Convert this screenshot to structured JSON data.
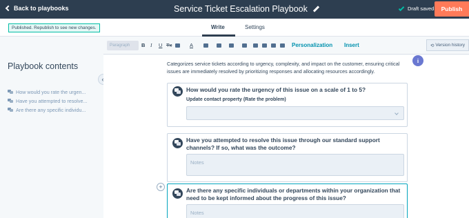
{
  "header": {
    "back_label": "Back to playbooks",
    "title": "Service Ticket Escalation Playbook",
    "save_status": "Draft saved",
    "publish_label": "Publish"
  },
  "tabs": {
    "status_message": "Published. Republish to see new changes.",
    "write_label": "Write",
    "settings_label": "Settings"
  },
  "sidebar": {
    "heading": "Playbook contents",
    "items": [
      {
        "label": "How would you rate the urgen..."
      },
      {
        "label": "Have you attempted to resolve..."
      },
      {
        "label": "Are there any specific individu..."
      }
    ]
  },
  "toolbar": {
    "paragraph_label": "Paragraph",
    "bold": "B",
    "italic": "I",
    "underline": "U",
    "strikethrough": "Tx",
    "font_color": "A",
    "personalization_label": "Personalization",
    "insert_label": "Insert",
    "version_history_label": "Version history"
  },
  "content": {
    "intro": "Categorizes service tickets according to urgency, complexity, and impact on the customer, ensuring critical issues are immediately resolved by prioritizing responses and allocating resources accordingly.",
    "questions": [
      {
        "text": "How would you rate the urgency of this issue on a scale of 1 to 5?",
        "property_label": "Update contact property (Rate the problem)"
      },
      {
        "text_line1": "Have you attempted to resolve this issue through our standard support",
        "text_line2": "channels? If so, what was the outcome?",
        "notes_placeholder": "Notes"
      },
      {
        "text_line1": "Are there any specific individuals or departments within your organization that",
        "text_line2": "need to be kept informed about the progress of this issue?",
        "notes_placeholder": "Notes"
      }
    ]
  },
  "icons": {
    "back": "chevron-left-icon",
    "edit": "pencil-icon",
    "saved": "checkmark-icon",
    "collapse": "double-chevron-left-icon",
    "info": "info-icon",
    "question": "chat-bubbles-icon",
    "add": "plus-icon"
  },
  "colors": {
    "topbar": "#2d3e50",
    "publish": "#ff7a59",
    "accent": "#00a4bd",
    "info": "#6a78d1"
  }
}
